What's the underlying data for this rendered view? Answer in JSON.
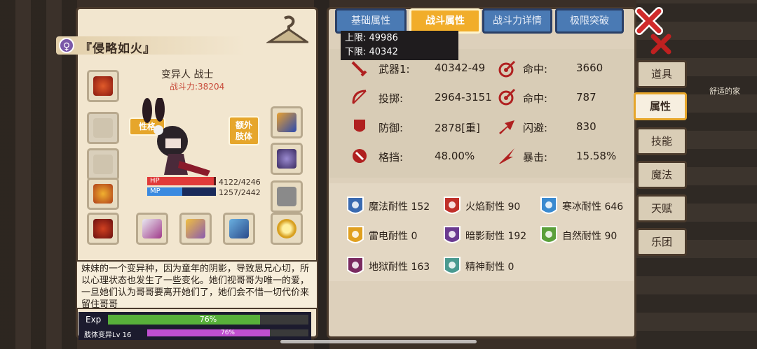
{
  "character": {
    "title": "『侵略如火』",
    "race_class": "变异人 战士",
    "power": "战斗力:38204",
    "tag_personality": "性格",
    "tag_extra_limb": "额外\n肢体",
    "hp_label": "HP",
    "mp_label": "MP",
    "hp": {
      "current": 4122,
      "max": 4246,
      "text": "4122/4246"
    },
    "mp": {
      "current": 1257,
      "max": 2442,
      "text": "1257/2442"
    },
    "description": "妹妹的一个变异种，因为童年的阴影，导致思兄心切，所以心理状态也发生了一些变化。她们视哥哥为唯一的爱，一旦她们认为哥哥要离开她们了，她们会不惜一切代价来留住哥哥",
    "exp_label": "Exp",
    "exp_percent": 76,
    "exp_text": "76%",
    "level_label": "肢体变异Lv 16",
    "level_percent": 76,
    "level_text": "76%"
  },
  "tabs": [
    {
      "label": "基础属性",
      "active": false
    },
    {
      "label": "战斗属性",
      "active": true
    },
    {
      "label": "战斗力详情",
      "active": false
    },
    {
      "label": "极限突破",
      "active": false
    }
  ],
  "tooltip": {
    "upper": "上限: 49986",
    "lower": "下限: 40342"
  },
  "stats": [
    {
      "label": "武器1:",
      "value": "40342-49",
      "icon": "sword-icon"
    },
    {
      "label": "命中:",
      "value": "3660",
      "icon": "target-icon"
    },
    {
      "label": "投掷:",
      "value": "2964-3151",
      "icon": "bow-icon"
    },
    {
      "label": "命中:",
      "value": "787",
      "icon": "target-icon"
    },
    {
      "label": "防御:",
      "value": "2878[重]",
      "icon": "shield-icon"
    },
    {
      "label": "闪避:",
      "value": "830",
      "icon": "dodge-icon"
    },
    {
      "label": "格挡:",
      "value": "48.00%",
      "icon": "block-icon"
    },
    {
      "label": "暴击:",
      "value": "15.58%",
      "icon": "critical-icon"
    }
  ],
  "resistances": [
    {
      "text": "魔法耐性 152",
      "color": "#3a6ab0",
      "icon": "magic-resist-icon"
    },
    {
      "text": "火焰耐性 90",
      "color": "#c0302a",
      "icon": "fire-resist-icon"
    },
    {
      "text": "寒冰耐性 646",
      "color": "#3a8ad0",
      "icon": "ice-resist-icon"
    },
    {
      "text": "雷电耐性 0",
      "color": "#e0a020",
      "icon": "thunder-resist-icon"
    },
    {
      "text": "暗影耐性 192",
      "color": "#6a3a90",
      "icon": "shadow-resist-icon"
    },
    {
      "text": "自然耐性 90",
      "color": "#5aa03a",
      "icon": "nature-resist-icon"
    },
    {
      "text": "地狱耐性 163",
      "color": "#7a2a60",
      "icon": "hell-resist-icon"
    },
    {
      "text": "精神耐性 0",
      "color": "#4a9a90",
      "icon": "spirit-resist-icon"
    }
  ],
  "side_tabs": [
    {
      "label": "道具",
      "active": false
    },
    {
      "label": "属性",
      "active": true
    },
    {
      "label": "技能",
      "active": false
    },
    {
      "label": "魔法",
      "active": false
    },
    {
      "label": "天赋",
      "active": false
    },
    {
      "label": "乐团",
      "active": false
    }
  ],
  "background": {
    "home_label": "舒适的家"
  },
  "colors": {
    "accent": "#f1ad2a",
    "tab_blue": "#4a7ab4",
    "hp": "#e03a3a",
    "mp": "#3a8ae0",
    "exp": "#58b03a",
    "level": "#c04fd0"
  }
}
